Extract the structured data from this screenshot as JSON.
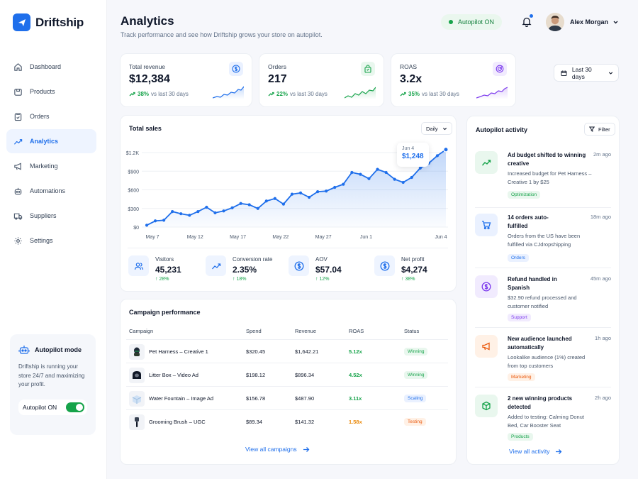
{
  "app": {
    "name": "Driftship"
  },
  "sidebar": {
    "items": [
      {
        "label": "Dashboard",
        "icon": "home-icon"
      },
      {
        "label": "Products",
        "icon": "box-icon"
      },
      {
        "label": "Orders",
        "icon": "clipboard-icon"
      },
      {
        "label": "Analytics",
        "icon": "trend-icon",
        "active": true
      },
      {
        "label": "Marketing",
        "icon": "megaphone-icon"
      },
      {
        "label": "Automations",
        "icon": "robot-icon"
      },
      {
        "label": "Suppliers",
        "icon": "truck-icon"
      },
      {
        "label": "Settings",
        "icon": "gear-icon"
      }
    ],
    "autopilot": {
      "title": "Autopilot mode",
      "description": "Driftship is running your store 24/7 and maximizing your profit.",
      "toggle_label": "Autopilot ON",
      "toggle_on": true
    }
  },
  "header": {
    "title": "Analytics",
    "subtitle": "Track performance and see how Driftship grows your store on autopilot.",
    "status_pill": "Autopilot ON",
    "user_name": "Alex Morgan",
    "date_range": "Last 30 days"
  },
  "kpis": [
    {
      "label": "Total revenue",
      "value": "$12,384",
      "delta": "38%",
      "compare": "vs last 30 days",
      "icon": "dollar-icon",
      "color": "#1f6feb"
    },
    {
      "label": "Orders",
      "value": "217",
      "delta": "22%",
      "compare": "vs last 30 days",
      "icon": "bag-icon",
      "color": "#16a34a"
    },
    {
      "label": "ROAS",
      "value": "3.2x",
      "delta": "35%",
      "compare": "vs last 30 days",
      "icon": "target-icon",
      "color": "#7c3aed"
    }
  ],
  "total_sales": {
    "title": "Total sales",
    "granularity": "Daily",
    "tooltip": {
      "date": "Jun 4",
      "value": "$1,248"
    }
  },
  "chart_data": {
    "type": "area",
    "title": "Total sales",
    "x_ticks": [
      "May 7",
      "May 12",
      "May 17",
      "May 22",
      "May 27",
      "Jun 1",
      "Jun 4"
    ],
    "y_ticks": [
      "$0",
      "$300",
      "$600",
      "$900",
      "$1.2K"
    ],
    "ylim": [
      0,
      1200
    ],
    "grid": true,
    "values": [
      30,
      100,
      110,
      250,
      215,
      190,
      250,
      320,
      230,
      260,
      310,
      380,
      360,
      300,
      420,
      460,
      370,
      530,
      550,
      480,
      570,
      580,
      640,
      690,
      880,
      850,
      780,
      930,
      880,
      770,
      720,
      800,
      950,
      1030,
      1150,
      1248
    ],
    "color": "#1f6feb"
  },
  "stats": [
    {
      "label": "Visitors",
      "value": "45,231",
      "delta": "28%",
      "icon": "users-icon"
    },
    {
      "label": "Conversion rate",
      "value": "2.35%",
      "delta": "18%",
      "icon": "trend-icon"
    },
    {
      "label": "AOV",
      "value": "$57.04",
      "delta": "12%",
      "icon": "dollar-icon"
    },
    {
      "label": "Net profit",
      "value": "$4,274",
      "delta": "38%",
      "icon": "dollar-icon"
    }
  ],
  "campaigns": {
    "title": "Campaign performance",
    "columns": [
      "Campaign",
      "Spend",
      "Revenue",
      "ROAS",
      "Status"
    ],
    "rows": [
      {
        "name": "Pet Harness – Creative 1",
        "spend": "$320.45",
        "revenue": "$1,642.21",
        "roas": "5.12x",
        "status": "Winning",
        "roas_color": "#16a34a",
        "status_color": "#16a34a",
        "status_bg": "#e9f7ee"
      },
      {
        "name": "Litter Box – Video Ad",
        "spend": "$198.12",
        "revenue": "$896.34",
        "roas": "4.52x",
        "status": "Winning",
        "roas_color": "#16a34a",
        "status_color": "#16a34a",
        "status_bg": "#e9f7ee"
      },
      {
        "name": "Water Fountain – Image Ad",
        "spend": "$156.78",
        "revenue": "$487.90",
        "roas": "3.11x",
        "status": "Scaling",
        "roas_color": "#16a34a",
        "status_color": "#1f6feb",
        "status_bg": "#eaf1ff"
      },
      {
        "name": "Grooming Brush – UGC",
        "spend": "$89.34",
        "revenue": "$141.32",
        "roas": "1.58x",
        "status": "Testing",
        "roas_color": "#ea8a0c",
        "status_color": "#ea580c",
        "status_bg": "#fff1e6"
      }
    ],
    "link": "View all campaigns"
  },
  "activity": {
    "title": "Autopilot activity",
    "filter": "Filter",
    "items": [
      {
        "title": "Ad budget shifted to winning creative",
        "time": "2m ago",
        "desc": "Increased budget for Pet Harness – Creative 1 by $25",
        "tag": "Optimization",
        "icon": "trend-icon",
        "tag_color": "#16a34a",
        "tag_bg": "#e9f7ee",
        "icon_bg": "#e9f7ee"
      },
      {
        "title": "14 orders auto-fulfilled",
        "time": "18m ago",
        "desc": "Orders from the US have been fulfilled via CJdropshipping",
        "tag": "Orders",
        "icon": "cart-icon",
        "tag_color": "#1f6feb",
        "tag_bg": "#eaf1ff",
        "icon_bg": "#eaf1ff"
      },
      {
        "title": "Refund handled in Spanish",
        "time": "45m ago",
        "desc": "$32.90 refund processed and customer notified",
        "tag": "Support",
        "icon": "dollar-icon",
        "tag_color": "#7c3aed",
        "tag_bg": "#f1ebfe",
        "icon_bg": "#f1ebfe"
      },
      {
        "title": "New audience launched automatically",
        "time": "1h ago",
        "desc": "Lookalike audience (1%) created from top customers",
        "tag": "Marketing",
        "icon": "megaphone-icon",
        "tag_color": "#ea580c",
        "tag_bg": "#fff1e6",
        "icon_bg": "#fff1e6"
      },
      {
        "title": "2 new winning products detected",
        "time": "2h ago",
        "desc": "Added to testing: Calming Donut Bed, Car Booster Seat",
        "tag": "Products",
        "icon": "cube-icon",
        "tag_color": "#16a34a",
        "tag_bg": "#e9f7ee",
        "icon_bg": "#e9f7ee"
      }
    ],
    "link": "View all activity"
  }
}
